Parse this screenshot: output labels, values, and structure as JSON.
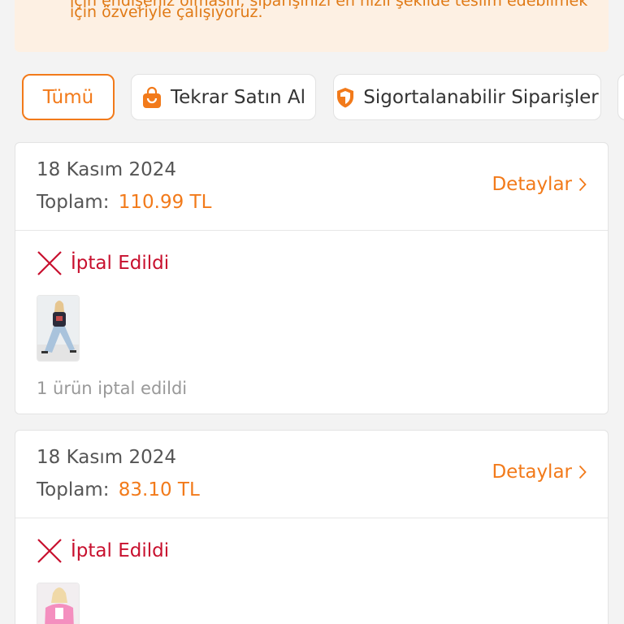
{
  "notice": {
    "line1": "için endişeniz olmasın, siparişinizi en hızlı şekilde teslim edebilmek",
    "line2": "için özveriyle çalışıyoruz."
  },
  "filters": [
    {
      "label": "Tümü",
      "active": true
    },
    {
      "label": "Tekrar Satın Al",
      "icon": "shopping-bag-icon",
      "active": false
    },
    {
      "label": "Sigortalanabilir Siparişler",
      "icon": "shield-icon",
      "active": false
    }
  ],
  "orders": [
    {
      "date": "18 Kasım 2024",
      "total_label": "Toplam:",
      "total": "110.99 TL",
      "details_label": "Detaylar",
      "status": "İptal Edildi",
      "note": "1 ürün iptal edildi"
    },
    {
      "date": "18 Kasım 2024",
      "total_label": "Toplam:",
      "total": "83.10 TL",
      "details_label": "Detaylar",
      "status": "İptal Edildi"
    }
  ],
  "colors": {
    "accent": "#f27a1a",
    "cancel": "#c8102e",
    "notice_bg": "#fdf0e3"
  }
}
